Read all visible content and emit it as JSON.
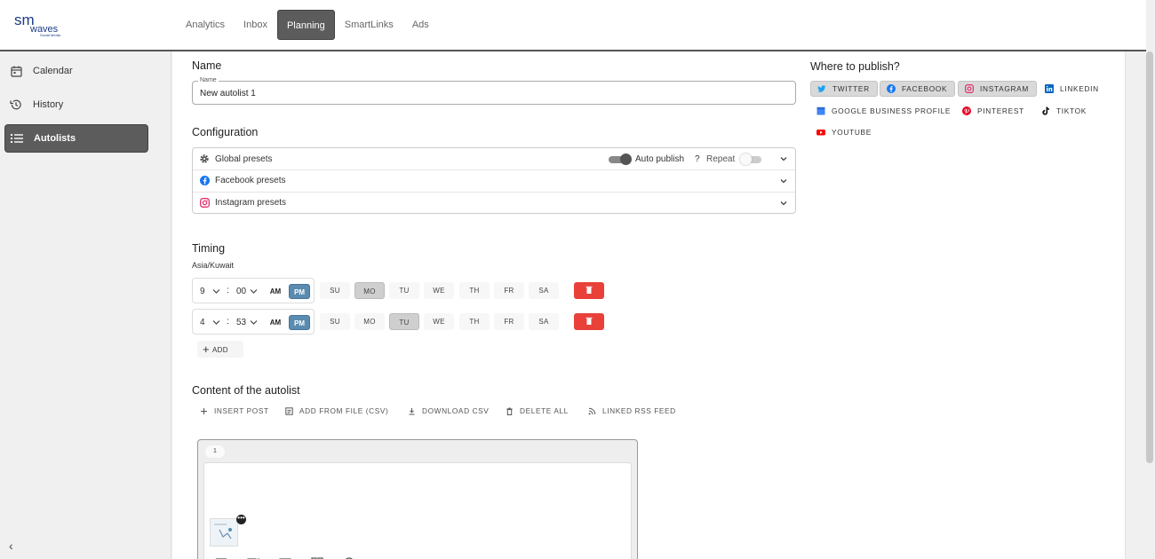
{
  "logo": {
    "primary": "sm",
    "secondary": "waves",
    "tagline": "Social Media"
  },
  "nav": {
    "tabs": [
      {
        "label": "Analytics",
        "active": false
      },
      {
        "label": "Inbox",
        "active": false
      },
      {
        "label": "Planning",
        "active": true
      },
      {
        "label": "SmartLinks",
        "active": false
      },
      {
        "label": "Ads",
        "active": false
      }
    ]
  },
  "sidebar": {
    "items": [
      {
        "label": "Calendar",
        "icon": "calendar-icon"
      },
      {
        "label": "History",
        "icon": "history-icon"
      },
      {
        "label": "Autolists",
        "icon": "list-icon",
        "active": true
      }
    ],
    "collapse_glyph": "‹"
  },
  "name_section": {
    "title": "Name",
    "field_label": "Name",
    "value": "New autolist 1"
  },
  "configuration": {
    "title": "Configuration",
    "rows": [
      {
        "label": "Global presets",
        "icon": "gear-icon"
      },
      {
        "label": "Facebook presets",
        "icon": "facebook-icon"
      },
      {
        "label": "Instagram presets",
        "icon": "instagram-icon"
      }
    ],
    "auto_publish_label": "Auto publish",
    "help_glyph": "?",
    "repeat_label": "Repeat",
    "auto_publish_on": true,
    "repeat_on": false
  },
  "timing": {
    "title": "Timing",
    "timezone": "Asia/Kuwait",
    "am_label": "AM",
    "pm_label": "PM",
    "days": [
      "SU",
      "MO",
      "TU",
      "WE",
      "TH",
      "FR",
      "SA"
    ],
    "schedules": [
      {
        "hour": "9",
        "minute": "00",
        "period": "PM",
        "selected_day": "MO"
      },
      {
        "hour": "4",
        "minute": "53",
        "period": "PM",
        "selected_day": "TU"
      }
    ],
    "add_label": "ADD",
    "add_glyph": "+"
  },
  "content": {
    "title": "Content of the autolist",
    "tools": [
      {
        "label": "INSERT POST",
        "icon": "plus-icon"
      },
      {
        "label": "ADD FROM FILE (CSV)",
        "icon": "file-icon"
      },
      {
        "label": "DOWNLOAD CSV",
        "icon": "download-icon"
      },
      {
        "label": "DELETE ALL",
        "icon": "trash-icon"
      },
      {
        "label": "LINKED RSS FEED",
        "icon": "rss-icon"
      }
    ],
    "post_number": "1",
    "more_glyph": "•••"
  },
  "publish": {
    "title": "Where to publish?",
    "networks": [
      {
        "label": "TWITTER",
        "selected": true,
        "color": "#1da1f2"
      },
      {
        "label": "FACEBOOK",
        "selected": true,
        "color": "#1877f2"
      },
      {
        "label": "INSTAGRAM",
        "selected": true,
        "color": "#e1306c"
      },
      {
        "label": "LINKEDIN",
        "selected": false,
        "color": "#0a66c2"
      },
      {
        "label": "GOOGLE BUSINESS PROFILE",
        "selected": false,
        "color": "#4285f4"
      },
      {
        "label": "PINTEREST",
        "selected": false,
        "color": "#e60023"
      },
      {
        "label": "TIKTOK",
        "selected": false,
        "color": "#111111"
      },
      {
        "label": "YOUTUBE",
        "selected": false,
        "color": "#ff0000"
      }
    ]
  },
  "colors": {
    "accent": "#5a8bb0",
    "danger": "#e9413a",
    "active_nav": "#5c5c5c"
  }
}
